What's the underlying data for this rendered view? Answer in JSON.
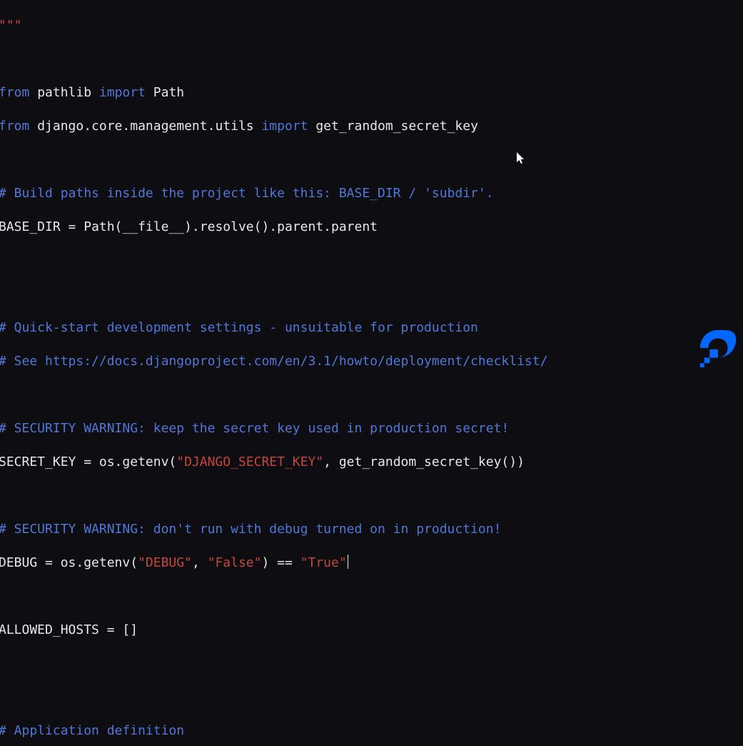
{
  "code": {
    "l1": "\"\"\"",
    "l2a": "from",
    "l2b": " pathlib ",
    "l2c": "import",
    "l2d": " Path",
    "l3a": "from",
    "l3b": " django.core.management.utils ",
    "l3c": "import",
    "l3d": " get_random_secret_key",
    "l4": "# Build paths inside the project like this: BASE_DIR / 'subdir'.",
    "l5a": "BASE_DIR = Path(",
    "l5b": "__file__",
    "l5c": ").resolve().parent.parent",
    "l6": "# Quick-start development settings - unsuitable for production",
    "l7": "# See https://docs.djangoproject.com/en/3.1/howto/deployment/checklist/",
    "l8": "# SECURITY WARNING: keep the secret key used in production secret!",
    "l9a": "SECRET_KEY = os.getenv(",
    "l9b": "\"DJANGO_SECRET_KEY\"",
    "l9c": ", get_random_secret_key())",
    "l10": "# SECURITY WARNING: don't run with debug turned on in production!",
    "l11a": "DEBUG = os.getenv(",
    "l11b": "\"DEBUG\"",
    "l11c": ", ",
    "l11d": "\"False\"",
    "l11e": ") == ",
    "l11f": "\"True\"",
    "l12": "ALLOWED_HOSTS = []",
    "l13": "# Application definition"
  },
  "brand": {
    "name": "digitalocean-logo"
  }
}
